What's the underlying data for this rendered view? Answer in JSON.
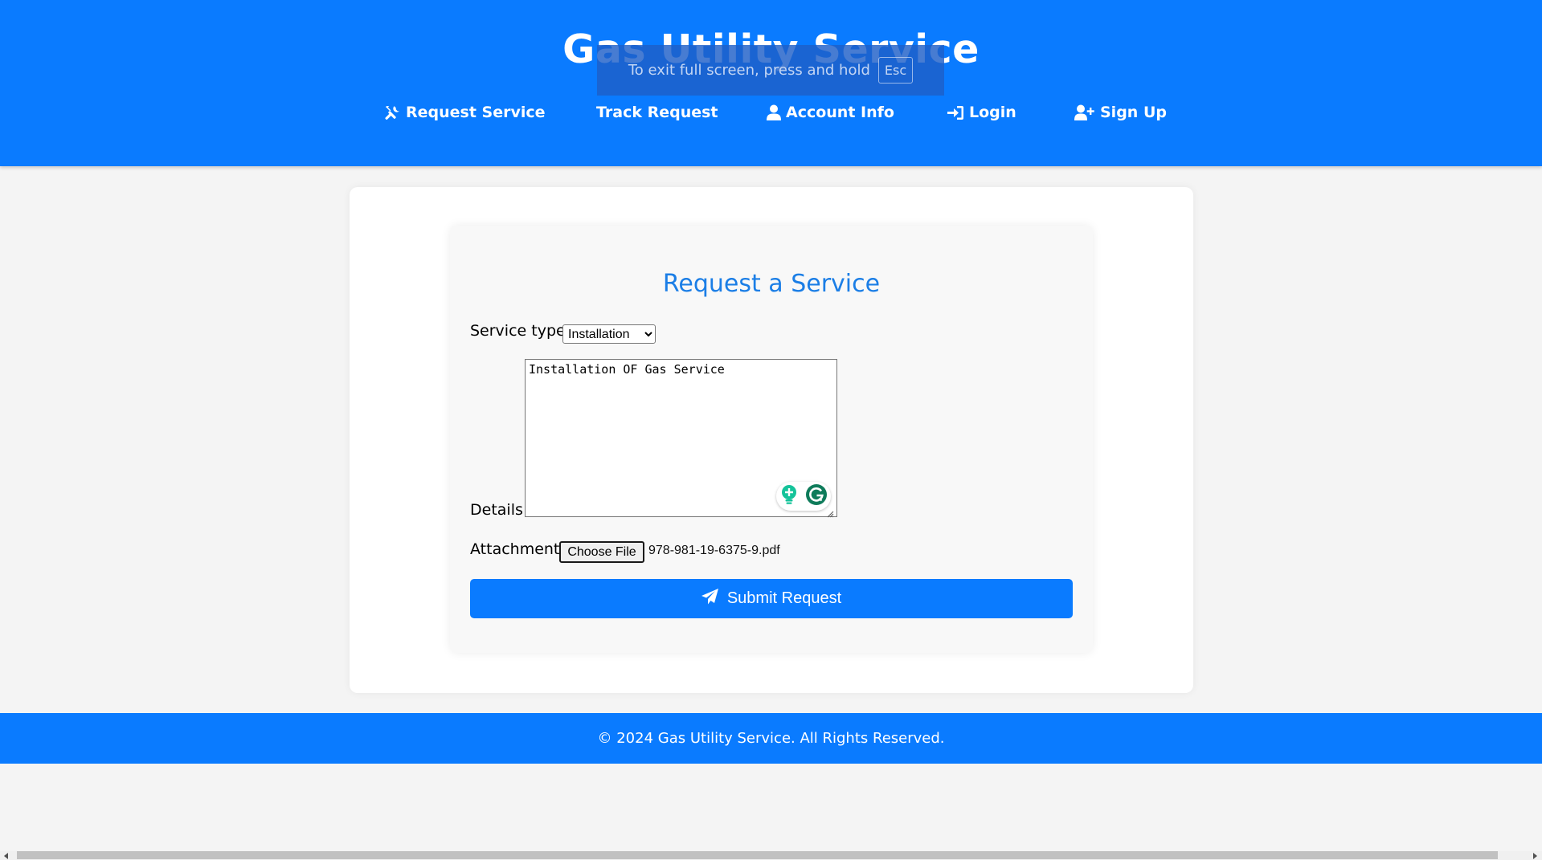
{
  "header": {
    "title": "Gas Utility Service",
    "nav": [
      {
        "label": "Request Service",
        "icon": "tools-icon"
      },
      {
        "label": "Track Request",
        "icon": ""
      },
      {
        "label": "Account Info",
        "icon": "user-icon"
      },
      {
        "label": "Login",
        "icon": "sign-in-icon"
      },
      {
        "label": "Sign Up",
        "icon": "user-plus-icon"
      }
    ]
  },
  "fullscreen_toast": {
    "message": "To exit full screen, press and hold",
    "key": "Esc"
  },
  "form": {
    "title": "Request a Service",
    "service_type_label": "Service type:",
    "service_type_selected": "Installation",
    "details_label": "Details:",
    "details_value": "Installation OF Gas Service",
    "attachment_label": "Attachment:",
    "choose_file_label": "Choose File",
    "file_name": "978-981-19-6375-9.pdf",
    "submit_label": "Submit Request"
  },
  "footer": {
    "text": "© 2024 Gas Utility Service. All Rights Reserved."
  },
  "colors": {
    "brand": "#0a7bff",
    "title_blue": "#1b7ee6",
    "background": "#f4f4f4",
    "grammarly_green": "#15c39a",
    "grammarly_dark": "#0e7b5a"
  }
}
